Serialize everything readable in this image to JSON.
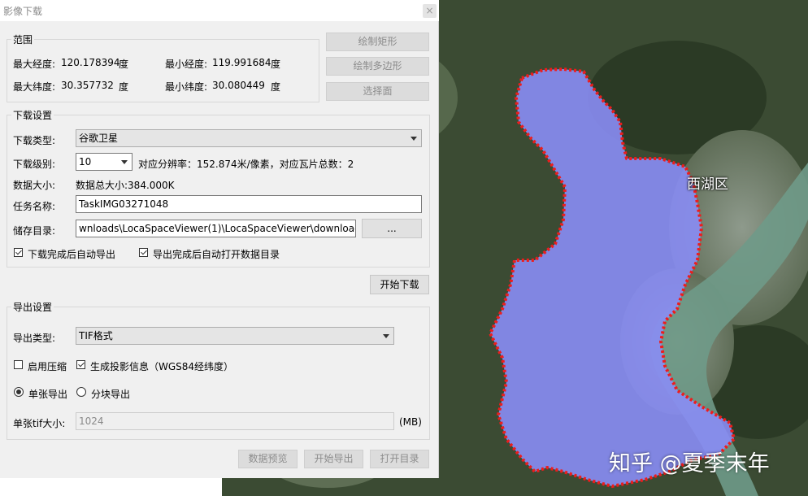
{
  "window": {
    "title": "影像下载",
    "close": "×"
  },
  "range": {
    "title": "范围",
    "max_lon_label": "最大经度:",
    "max_lon": "120.178394",
    "unit_deg": "度",
    "min_lon_label": "最小经度:",
    "min_lon": "119.991684",
    "max_lat_label": "最大纬度:",
    "max_lat": "30.357732",
    "min_lat_label": "最小纬度:",
    "min_lat": "30.080449",
    "draw_rect": "绘制矩形",
    "draw_polygon": "绘制多边形",
    "select_face": "选择面"
  },
  "download": {
    "title": "下载设置",
    "type_label": "下载类型:",
    "type_value": "谷歌卫星",
    "level_label": "下载级别:",
    "level_value": "10",
    "resolution_text": "对应分辨率：152.874米/像素，对应瓦片总数：2",
    "size_label": "数据大小:",
    "size_value": "数据总大小:384.000K",
    "task_label": "任务名称:",
    "task_value": "TaskIMG03271048",
    "dir_label": "储存目录:",
    "dir_value": "wnloads\\LocaSpaceViewer(1)\\LocaSpaceViewer\\download",
    "browse": "...",
    "auto_export": "下载完成后自动导出",
    "auto_open": "导出完成后自动打开数据目录",
    "start": "开始下载"
  },
  "export": {
    "title": "导出设置",
    "type_label": "导出类型:",
    "type_value": "TIF格式",
    "compress": "启用压缩",
    "projection": "生成投影信息（WGS84经纬度）",
    "single": "单张导出",
    "tiled": "分块导出",
    "tif_size_label": "单张tif大小:",
    "tif_size_value": "1024",
    "unit_mb": "(MB)",
    "preview": "数据预览",
    "start": "开始导出",
    "open_dir": "打开目录"
  },
  "map": {
    "district": "西湖区",
    "watermark": "知乎 @夏季末年"
  },
  "colors": {
    "polygon_fill": "#8a8df5",
    "polygon_edge": "#ee1c1c",
    "river": "#6f9a88"
  }
}
